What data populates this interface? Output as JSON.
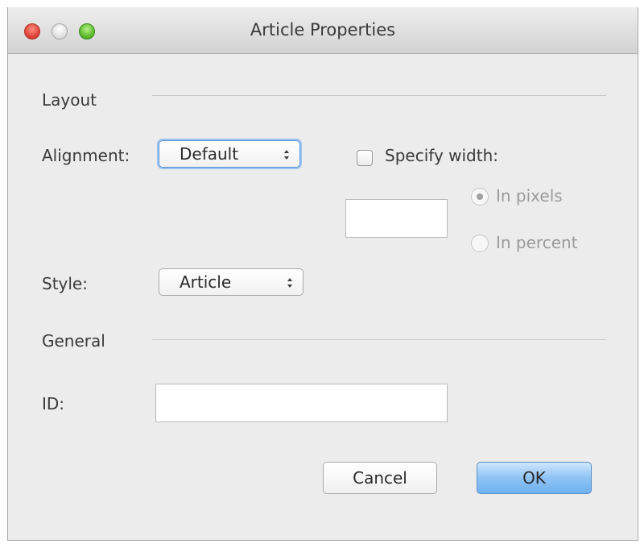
{
  "window": {
    "title": "Article Properties"
  },
  "layout_section": {
    "label": "Layout",
    "alignment_label": "Alignment:",
    "alignment_value": "Default",
    "specify_width_label": "Specify width:",
    "specify_width_checked": false,
    "width_value": "",
    "in_pixels_label": "In pixels",
    "in_pixels_selected": true,
    "in_percent_label": "In percent",
    "in_percent_selected": false,
    "style_label": "Style:",
    "style_value": "Article"
  },
  "general_section": {
    "label": "General",
    "id_label": "ID:",
    "id_value": ""
  },
  "buttons": {
    "cancel_label": "Cancel",
    "ok_label": "OK"
  },
  "colors": {
    "close": "#e0463b",
    "minimize": "#d6d6d6",
    "maximize": "#5fbc2e",
    "ok_button": "#8ec3f5",
    "focus_ring": "#9cc3f0"
  }
}
